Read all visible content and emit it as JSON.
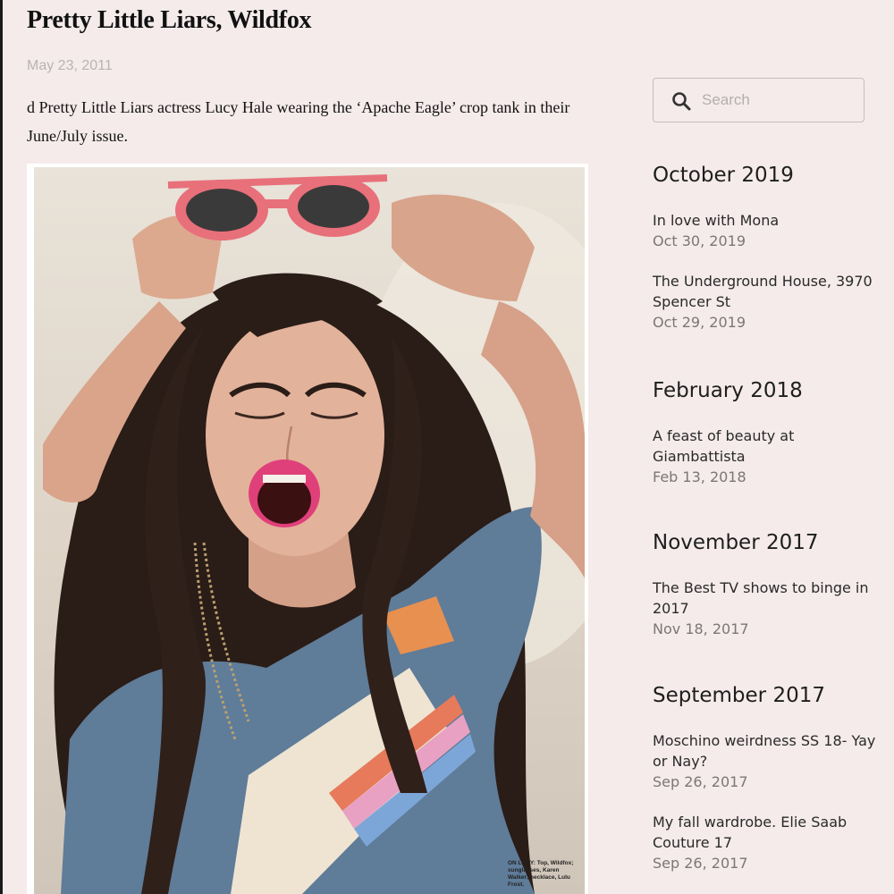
{
  "post": {
    "title": "Pretty Little Liars, Wildfox",
    "date": "May 23, 2011",
    "body": "d Pretty Little Liars actress Lucy Hale wearing the ‘Apache Eagle’ crop tank in their June/July issue.",
    "photo_credit": "ON LUCY: Top, Wildfox; sunglasses, Karen Walker; necklace, Lulu Frost."
  },
  "search": {
    "placeholder": "Search"
  },
  "archive": [
    {
      "heading": "October 2019",
      "items": [
        {
          "title": "In love with Mona",
          "date": "Oct 30, 2019"
        },
        {
          "title": "The Underground House, 3970 Spencer St",
          "date": "Oct 29, 2019"
        }
      ]
    },
    {
      "heading": "February 2018",
      "items": [
        {
          "title": "A feast of beauty at Giambattista",
          "date": "Feb 13, 2018"
        }
      ]
    },
    {
      "heading": "November 2017",
      "items": [
        {
          "title": "The Best TV shows to binge in 2017",
          "date": "Nov 18, 2017"
        }
      ]
    },
    {
      "heading": "September 2017",
      "items": [
        {
          "title": "Moschino weirdness SS 18- Yay or Nay?",
          "date": "Sep 26, 2017"
        },
        {
          "title": "My fall wardrobe. Elie Saab Couture 17",
          "date": "Sep 26, 2017"
        }
      ]
    }
  ],
  "colors": {
    "background": "#f5ebeb",
    "text": "#111111",
    "muted": "#7c7676",
    "sunglasses": "#e8707a",
    "lips": "#e0407a",
    "shirt": "#5f7c99"
  },
  "icons": {
    "search": "search-icon"
  }
}
